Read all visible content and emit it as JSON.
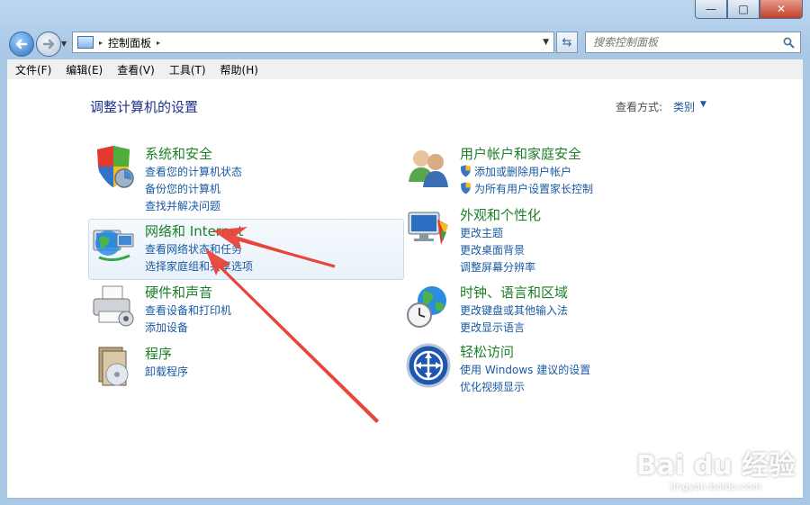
{
  "window": {
    "controls": {
      "minimize": "—",
      "maximize": "□",
      "close": "✕"
    }
  },
  "nav": {
    "back_icon": "back-arrow-icon",
    "forward_icon": "forward-arrow-icon",
    "address_separator": "▸",
    "address_path": "控制面板",
    "address_trail_separator": "▸",
    "search_placeholder": "搜索控制面板"
  },
  "menu": {
    "items": [
      "文件(F)",
      "编辑(E)",
      "查看(V)",
      "工具(T)",
      "帮助(H)"
    ]
  },
  "main": {
    "title": "调整计算机的设置",
    "view_by_label": "查看方式:",
    "view_by_value": "类别"
  },
  "categories": [
    {
      "title": "系统和安全",
      "icon": "shield-computer-icon",
      "links": [
        "查看您的计算机状态",
        "备份您的计算机",
        "查找并解决问题"
      ]
    },
    {
      "title": "网络和 Internet",
      "icon": "network-globe-icon",
      "links": [
        "查看网络状态和任务",
        "选择家庭组和共享选项"
      ]
    },
    {
      "title": "硬件和声音",
      "icon": "printer-icon",
      "links": [
        "查看设备和打印机",
        "添加设备"
      ]
    },
    {
      "title": "程序",
      "icon": "programs-icon",
      "links": [
        "卸载程序"
      ]
    },
    {
      "title": "用户帐户和家庭安全",
      "icon": "users-icon",
      "links": [
        "添加或删除用户帐户",
        "为所有用户设置家长控制"
      ]
    },
    {
      "title": "外观和个性化",
      "icon": "monitor-palette-icon",
      "links": [
        "更改主题",
        "更改桌面背景",
        "调整屏幕分辨率"
      ]
    },
    {
      "title": "时钟、语言和区域",
      "icon": "clock-globe-icon",
      "links": [
        "更改键盘或其他输入法",
        "更改显示语言"
      ]
    },
    {
      "title": "轻松访问",
      "icon": "ease-of-access-icon",
      "links": [
        "使用 Windows 建议的设置",
        "优化视频显示"
      ]
    }
  ],
  "watermark": {
    "logo": "Bai du 经验",
    "url": "jingyan.baidu.com"
  },
  "colors": {
    "category_title": "#1e7f2a",
    "link": "#1a5aa3",
    "annotation_arrow": "#e8443a"
  }
}
